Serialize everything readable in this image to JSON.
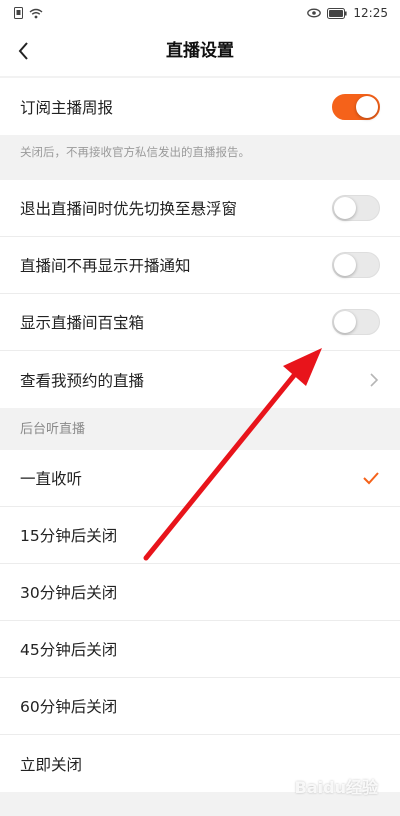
{
  "status_bar": {
    "time": "12:25",
    "icons": [
      "sim-icon",
      "wifi-icon",
      "eye-icon",
      "battery-icon"
    ]
  },
  "header": {
    "back_icon": "chevron-left-icon",
    "title": "直播设置"
  },
  "subscribe": {
    "label": "订阅主播周报",
    "enabled": true,
    "hint": "关闭后，不再接收官方私信发出的直播报告。"
  },
  "settings": [
    {
      "label": "退出直播间时优先切换至悬浮窗",
      "enabled": false
    },
    {
      "label": "直播间不再显示开播通知",
      "enabled": false
    },
    {
      "label": "显示直播间百宝箱",
      "enabled": false
    }
  ],
  "reservations": {
    "label": "查看我预约的直播"
  },
  "background_listen": {
    "header": "后台听直播",
    "options": [
      {
        "label": "一直收听",
        "selected": true
      },
      {
        "label": "15分钟后关闭",
        "selected": false
      },
      {
        "label": "30分钟后关闭",
        "selected": false
      },
      {
        "label": "45分钟后关闭",
        "selected": false
      },
      {
        "label": "60分钟后关闭",
        "selected": false
      },
      {
        "label": "立即关闭",
        "selected": false
      }
    ]
  },
  "colors": {
    "accent": "#f5621a",
    "annotation_arrow": "#e8141b"
  },
  "watermark": {
    "text": "Baidu经验"
  }
}
